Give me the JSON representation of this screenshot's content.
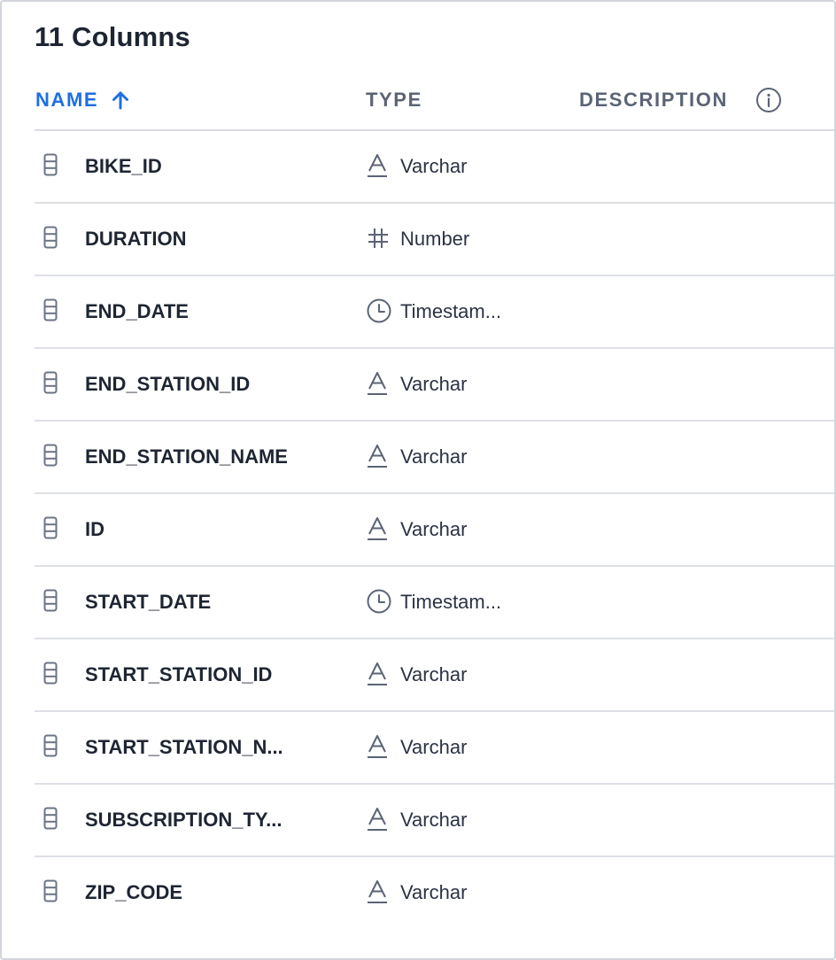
{
  "title": "11 Columns",
  "header": {
    "name": "NAME",
    "type": "TYPE",
    "description": "DESCRIPTION",
    "sort_direction": "ascending",
    "icons": {
      "sort": "arrow-up-icon",
      "info": "info-icon"
    }
  },
  "colors": {
    "accent": "#1f6fe0",
    "muted": "#5b6476",
    "text": "#1e2533",
    "border": "#d2d5db"
  },
  "columns": [
    {
      "name": "BIKE_ID",
      "type": "Varchar",
      "type_icon": "text-type-icon",
      "description": ""
    },
    {
      "name": "DURATION",
      "type": "Number",
      "type_icon": "hash-icon",
      "description": ""
    },
    {
      "name": "END_DATE",
      "type": "Timestam...",
      "type_icon": "clock-icon",
      "description": ""
    },
    {
      "name": "END_STATION_ID",
      "type": "Varchar",
      "type_icon": "text-type-icon",
      "description": ""
    },
    {
      "name": "END_STATION_NAME",
      "type": "Varchar",
      "type_icon": "text-type-icon",
      "description": ""
    },
    {
      "name": "ID",
      "type": "Varchar",
      "type_icon": "text-type-icon",
      "description": ""
    },
    {
      "name": "START_DATE",
      "type": "Timestam...",
      "type_icon": "clock-icon",
      "description": ""
    },
    {
      "name": "START_STATION_ID",
      "type": "Varchar",
      "type_icon": "text-type-icon",
      "description": ""
    },
    {
      "name": "START_STATION_N...",
      "type": "Varchar",
      "type_icon": "text-type-icon",
      "description": ""
    },
    {
      "name": "SUBSCRIPTION_TY...",
      "type": "Varchar",
      "type_icon": "text-type-icon",
      "description": ""
    },
    {
      "name": "ZIP_CODE",
      "type": "Varchar",
      "type_icon": "text-type-icon",
      "description": ""
    }
  ]
}
